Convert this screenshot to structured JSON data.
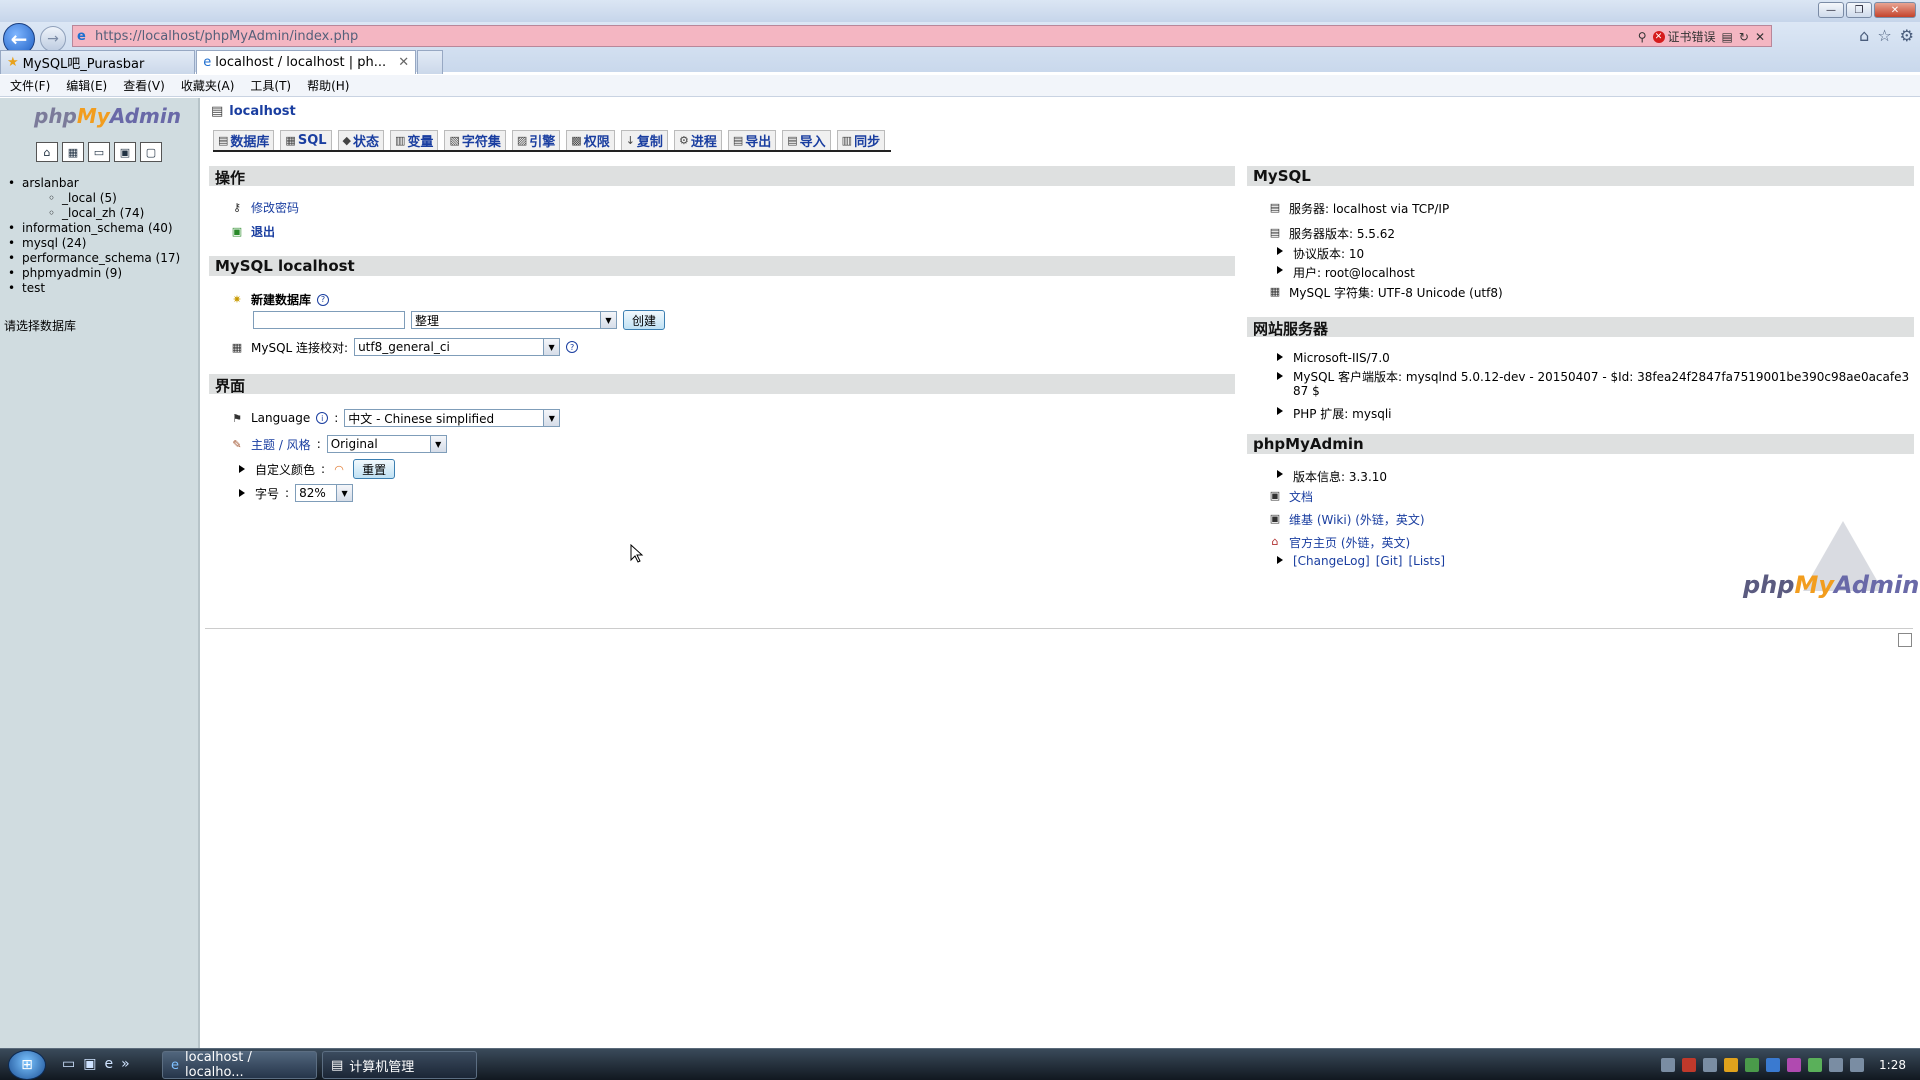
{
  "browser": {
    "url_host": "https://localhost",
    "url_path": "/phpMyAdmin/index.php",
    "cert_error": "证书错误",
    "tabs": [
      {
        "label": "MySQL吧_Purasbar"
      },
      {
        "label": "localhost / localhost | ph..."
      }
    ],
    "menu": [
      "文件(F)",
      "编辑(E)",
      "查看(V)",
      "收藏夹(A)",
      "工具(T)",
      "帮助(H)"
    ]
  },
  "left": {
    "logo": {
      "php": "php",
      "my": "My",
      "admin": "Admin"
    },
    "databases": [
      {
        "name": "arslanbar",
        "children": [
          "_local (5)",
          "_local_zh (74)"
        ]
      },
      {
        "name": "information_schema (40)"
      },
      {
        "name": "mysql (24)"
      },
      {
        "name": "performance_schema (17)"
      },
      {
        "name": "phpmyadmin (9)"
      },
      {
        "name": "test"
      }
    ],
    "select_db_hint": "请选择数据库"
  },
  "main": {
    "server": "localhost",
    "topmenu": [
      "数据库",
      "SQL",
      "状态",
      "变量",
      "字符集",
      "引擎",
      "权限",
      "复制",
      "进程",
      "导出",
      "导入",
      "同步"
    ],
    "ops": {
      "title": "操作",
      "change_password": "修改密码",
      "logout": "退出"
    },
    "mysql_local": {
      "title": "MySQL localhost",
      "create_db_label": "新建数据库",
      "collation_select": "整理",
      "create_button": "创建",
      "conn_collation_label": "MySQL 连接校对:",
      "conn_collation_value": "utf8_general_ci"
    },
    "ui": {
      "title": "界面",
      "language_label": "Language",
      "language_value": "中文 - Chinese simplified",
      "theme_label": "主题 / 风格",
      "theme_value": "Original",
      "custom_color_label": "自定义颜色",
      "reset_button": "重置",
      "font_size_label": "字号",
      "font_size_value": "82%"
    },
    "mysql_info": {
      "title": "MySQL",
      "server": "服务器: localhost via TCP/IP",
      "server_version": "服务器版本: 5.5.62",
      "protocol": "协议版本: 10",
      "user": "用户: root@localhost",
      "charset": "MySQL 字符集: UTF-8 Unicode (utf8)"
    },
    "web_server": {
      "title": "网站服务器",
      "iis": "Microsoft-IIS/7.0",
      "client": "MySQL 客户端版本: mysqlnd 5.0.12-dev - 20150407 - $Id: 38fea24f2847fa7519001be390c98ae0acafe387 $",
      "php_ext": "PHP 扩展: mysqli"
    },
    "pma": {
      "title": "phpMyAdmin",
      "version": "版本信息: 3.3.10",
      "docs": "文档",
      "wiki": "维基 (Wiki) (外链，英文)",
      "homepage": "官方主页 (外链，英文)",
      "changelog": "[ChangeLog]",
      "git": "[Git]",
      "lists": "[Lists]"
    }
  },
  "taskbar": {
    "items": [
      "localhost / localho...",
      "计算机管理"
    ],
    "clock": "1:28"
  }
}
